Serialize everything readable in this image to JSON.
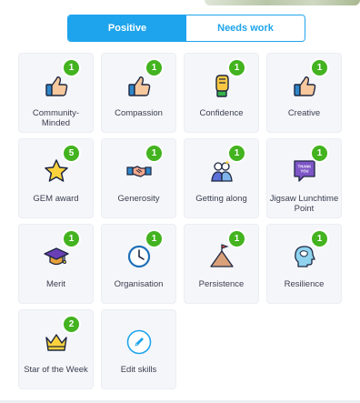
{
  "tabs": {
    "positive": "Positive",
    "needs_work": "Needs work"
  },
  "skills": [
    {
      "label": "Community-\nMinded",
      "count": "1",
      "icon": "thumbs-up-icon"
    },
    {
      "label": "Compassion",
      "count": "1",
      "icon": "thumbs-up-icon"
    },
    {
      "label": "Confidence",
      "count": "1",
      "icon": "raised-fist-icon"
    },
    {
      "label": "Creative",
      "count": "1",
      "icon": "thumbs-up-icon"
    },
    {
      "label": "GEM award",
      "count": "5",
      "icon": "star-icon"
    },
    {
      "label": "Generosity",
      "count": "1",
      "icon": "handshake-icon"
    },
    {
      "label": "Getting along",
      "count": "1",
      "icon": "friends-icon"
    },
    {
      "label": "Jigsaw Lunchtime Point",
      "count": "1",
      "icon": "thank-you-card-icon",
      "icon_text": "THANK YOU"
    },
    {
      "label": "Merit",
      "count": "1",
      "icon": "graduation-cap-icon"
    },
    {
      "label": "Organisation",
      "count": "1",
      "icon": "clock-icon"
    },
    {
      "label": "Persistence",
      "count": "1",
      "icon": "mountain-flag-icon"
    },
    {
      "label": "Resilience",
      "count": "1",
      "icon": "head-bandage-icon"
    },
    {
      "label": "Star of the Week",
      "count": "2",
      "icon": "crown-icon"
    },
    {
      "label": "Edit skills",
      "icon": "pencil-icon"
    }
  ]
}
